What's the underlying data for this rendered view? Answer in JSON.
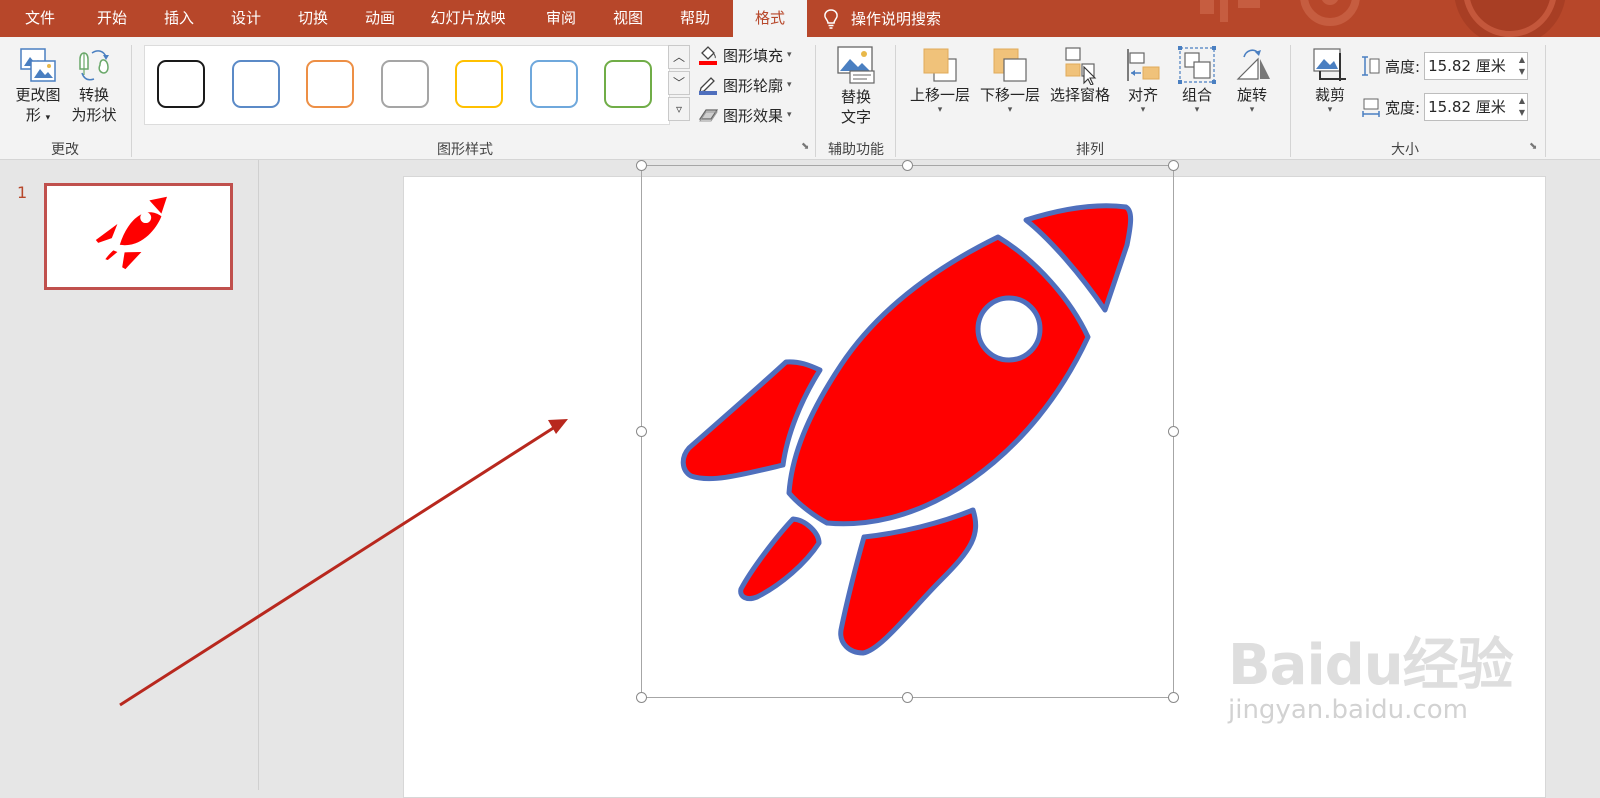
{
  "tabs": [
    {
      "label": "文件",
      "name": "tab-file"
    },
    {
      "label": "开始",
      "name": "tab-home"
    },
    {
      "label": "插入",
      "name": "tab-insert"
    },
    {
      "label": "设计",
      "name": "tab-design"
    },
    {
      "label": "切换",
      "name": "tab-transitions"
    },
    {
      "label": "动画",
      "name": "tab-animations"
    },
    {
      "label": "幻灯片放映",
      "name": "tab-slideshow"
    },
    {
      "label": "审阅",
      "name": "tab-review"
    },
    {
      "label": "视图",
      "name": "tab-view"
    },
    {
      "label": "帮助",
      "name": "tab-help"
    },
    {
      "label": "格式",
      "name": "tab-format",
      "active": true
    }
  ],
  "tell_me": {
    "label": "操作说明搜索",
    "icon": "lightbulb-icon"
  },
  "groups": {
    "change": {
      "label": "更改",
      "change_graphic": {
        "line1": "更改图",
        "line2": "形",
        "icon": "change-graphic-icon"
      },
      "convert_shape": {
        "line1": "转换",
        "line2": "为形状",
        "icon": "convert-to-shape-icon"
      }
    },
    "graphic_styles": {
      "label": "图形样式",
      "swatch_colors": [
        "#1a1a1a",
        "#5b8ac7",
        "#ed8f45",
        "#a5a5a5",
        "#ffc000",
        "#6fa8dc",
        "#70ad47"
      ],
      "fill": "图形填充",
      "outline": "图形轮廓",
      "effects": "图形效果"
    },
    "accessibility": {
      "label": "辅助功能",
      "alt_text": {
        "line1": "替换",
        "line2": "文字",
        "icon": "alt-text-icon"
      }
    },
    "arrange": {
      "label": "排列",
      "bring_forward": "上移一层",
      "send_backward": "下移一层",
      "selection_pane": "选择窗格",
      "align": "对齐",
      "group": "组合",
      "rotate": "旋转"
    },
    "size": {
      "label": "大小",
      "crop": "裁剪",
      "height_label": "高度:",
      "height_value": "15.82 厘米",
      "width_label": "宽度:",
      "width_value": "15.82 厘米"
    }
  },
  "slides_panel": {
    "slide_number": "1"
  },
  "canvas": {
    "shape": "rocket-icon",
    "shape_fill": "#ff0000",
    "shape_outline": "#4f6fbd",
    "annotation_arrow_color": "#b8281e"
  },
  "watermark": {
    "brand": "Baidu经验",
    "url": "jingyan.baidu.com"
  },
  "colors": {
    "accent": "#b7472a",
    "ribbon": "#f3f3f3"
  }
}
